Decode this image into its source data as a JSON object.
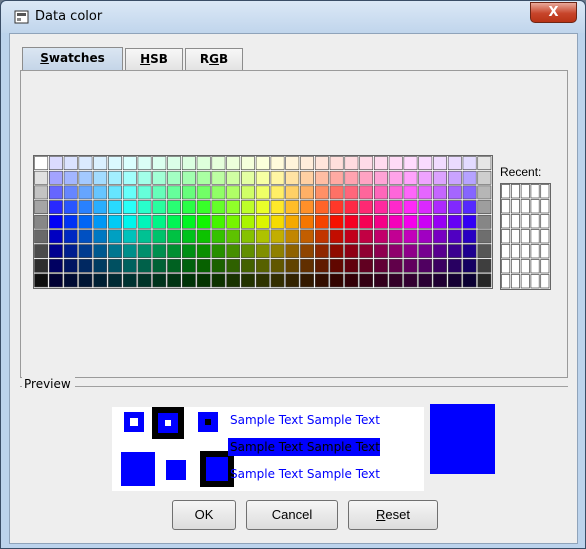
{
  "window": {
    "title": "Data color",
    "close_label": "X"
  },
  "tabs": [
    {
      "label": "Swatches",
      "mnemonic": "S",
      "rest": "watches",
      "active": true
    },
    {
      "label": "HSB",
      "mnemonic": "H",
      "rest": "SB",
      "active": false
    },
    {
      "label": "RGB",
      "mnemonic": "G",
      "pre": "R",
      "rest": "B",
      "active": false
    }
  ],
  "swatches": {
    "recent_label": "Recent:",
    "columns": 31,
    "rows": 9,
    "recent_columns": 5,
    "recent_rows": 7
  },
  "preview": {
    "legend": "Preview",
    "sample_text": "Sample Text",
    "color": "#0000ff"
  },
  "buttons": {
    "ok": "OK",
    "cancel": "Cancel",
    "reset": "Reset",
    "reset_mnemonic": "R",
    "reset_rest": "eset"
  }
}
